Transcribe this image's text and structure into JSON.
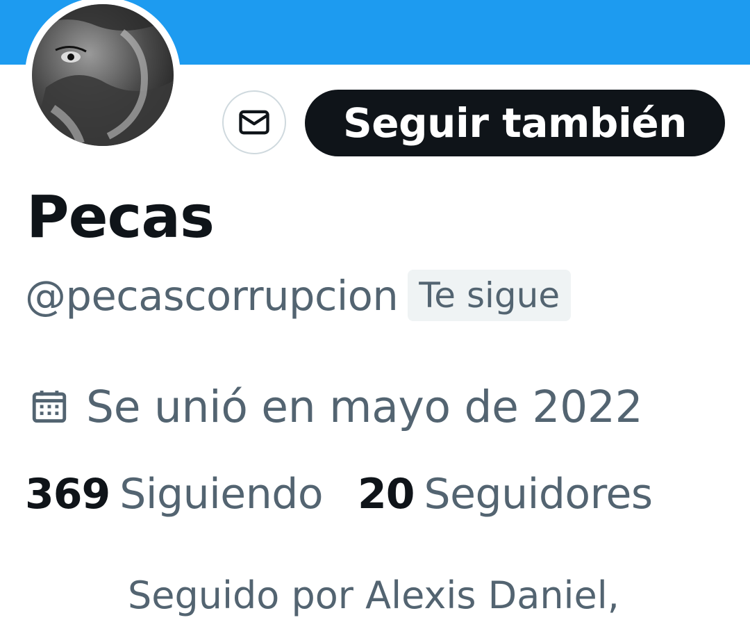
{
  "colors": {
    "banner": "#1d9bf0",
    "primary_text": "#0f1419",
    "secondary_text": "#536471",
    "follow_button_bg": "#0f1419",
    "badge_bg": "#eff3f4",
    "border": "#cfd9de"
  },
  "profile": {
    "avatar_icon": "wolf-avatar",
    "message_icon": "mail-icon",
    "follow_label": "Seguir también",
    "display_name": "Pecas",
    "handle": "@pecascorrupcion",
    "follows_you_label": "Te sigue",
    "joined_icon": "calendar-icon",
    "joined": "Se unió en mayo de 2022"
  },
  "stats": {
    "following_count": "369",
    "following_label": "Siguiendo",
    "followers_count": "20",
    "followers_label": "Seguidores"
  },
  "followed_by": "Seguido por Alexis Daniel,"
}
